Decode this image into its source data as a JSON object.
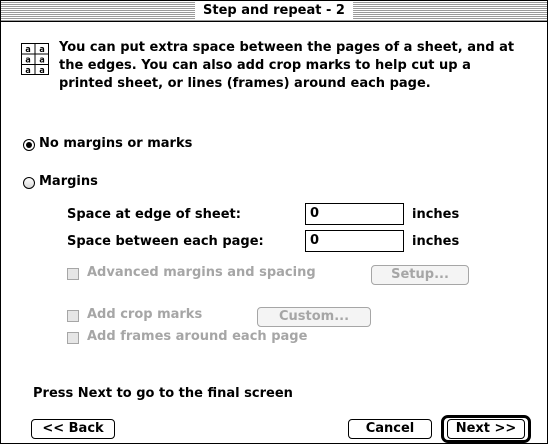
{
  "window": {
    "title": "Step and repeat - 2"
  },
  "intro": {
    "icon_letter": "a",
    "text": "You can put extra space between the pages of a sheet, and at the edges. You can also add crop marks to help cut up a printed sheet, or lines (frames) around each page."
  },
  "options": {
    "no_margins_label": "No margins or marks",
    "no_margins_selected": true,
    "margins_label": "Margins",
    "margins_selected": false
  },
  "fields": {
    "edge_label": "Space at edge of sheet:",
    "edge_value": "0",
    "edge_unit": "inches",
    "between_label": "Space between each page:",
    "between_value": "0",
    "between_unit": "inches"
  },
  "advanced": {
    "label": "Advanced margins and spacing",
    "setup_button": "Setup..."
  },
  "crop": {
    "label": "Add crop marks",
    "custom_button": "Custom..."
  },
  "frames": {
    "label": "Add frames around each page"
  },
  "footer": {
    "hint": "Press Next to go to the final screen",
    "back": "<< Back",
    "cancel": "Cancel",
    "next": "Next >>"
  }
}
